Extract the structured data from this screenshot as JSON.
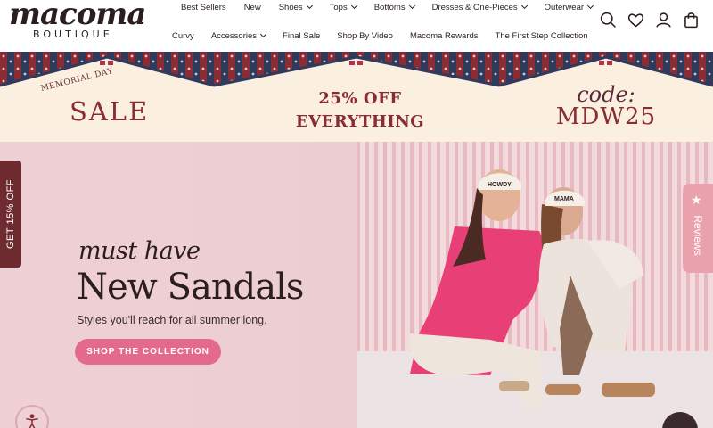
{
  "logo": {
    "script": "macoma",
    "sub": "BOUTIQUE"
  },
  "nav": {
    "row1": [
      {
        "label": "Best Sellers",
        "dropdown": false
      },
      {
        "label": "New",
        "dropdown": false
      },
      {
        "label": "Shoes",
        "dropdown": true
      },
      {
        "label": "Tops",
        "dropdown": true
      },
      {
        "label": "Bottoms",
        "dropdown": true
      },
      {
        "label": "Dresses & One-Pieces",
        "dropdown": true
      },
      {
        "label": "Outerwear",
        "dropdown": true
      }
    ],
    "row2": [
      {
        "label": "Curvy",
        "dropdown": false
      },
      {
        "label": "Accessories",
        "dropdown": true
      },
      {
        "label": "Final Sale",
        "dropdown": false
      },
      {
        "label": "Shop By Video",
        "dropdown": false
      },
      {
        "label": "Macoma Rewards",
        "dropdown": false
      },
      {
        "label": "The First Step Collection",
        "dropdown": false
      }
    ]
  },
  "header_icons": [
    "search-icon",
    "heart-icon",
    "account-icon",
    "cart-icon"
  ],
  "promo": {
    "memorial": "MEMORIAL DAY",
    "sale": "SALE",
    "offer_line1": "25% OFF",
    "offer_line2": "EVERYTHING",
    "code_label": "code:",
    "code_value": "MDW25"
  },
  "hero": {
    "eyebrow": "must have",
    "headline": "New Sandals",
    "subline": "Styles you'll reach for all summer long.",
    "cta": "SHOP THE COLLECTION",
    "cap_text_1": "HOWDY",
    "cap_text_2": "MAMA"
  },
  "side_tab": "GET 15% OFF",
  "reviews_tab": "Reviews",
  "colors": {
    "brand": "#2b1e1e",
    "accent_pink": "#e36a8a",
    "promo_red": "#8a2c33",
    "side_tab": "#6e2c30",
    "reviews_tab": "#e9a1ad"
  }
}
